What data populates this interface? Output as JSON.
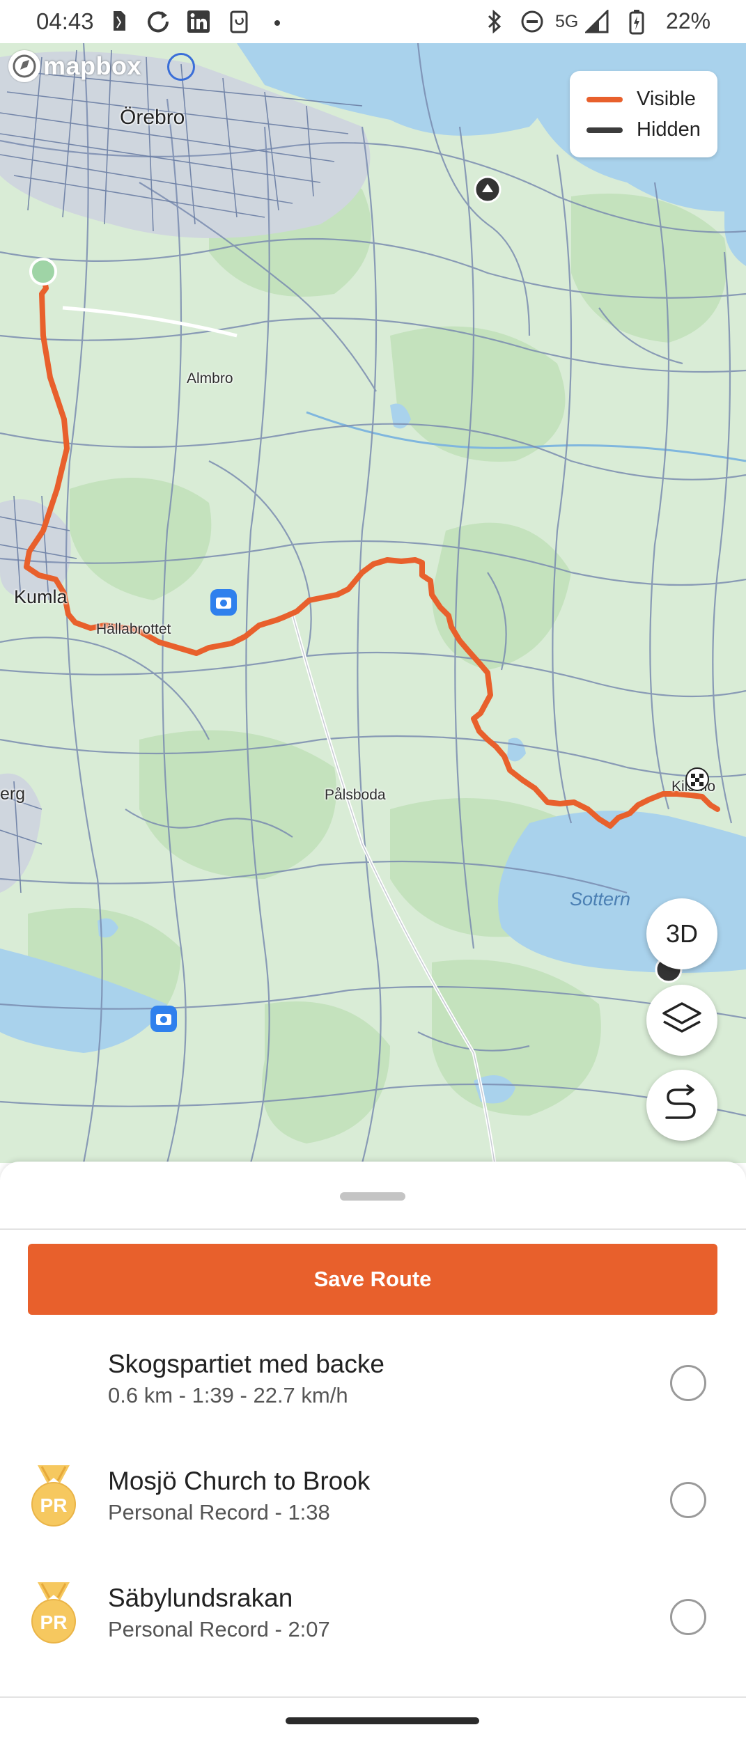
{
  "status_bar": {
    "time": "04:43",
    "network": "5G",
    "battery": "22%",
    "icons": [
      "sim-card-icon",
      "sync-icon",
      "linkedin-icon",
      "clipboard-icon",
      "dot-icon",
      "bluetooth-icon",
      "do-not-disturb-icon",
      "signal-icon",
      "battery-charging-icon"
    ]
  },
  "map": {
    "logo_text": "mapbox",
    "legend": [
      {
        "label": "Visible",
        "color": "#e8602c"
      },
      {
        "label": "Hidden",
        "color": "#3c3c3c"
      }
    ],
    "places": {
      "orebro": "Örebro",
      "almbro": "Almbro",
      "kumla": "Kumla",
      "hallabrottet": "Hällabrottet",
      "palsboda": "Pålsboda",
      "erg": "erg",
      "kilsmo": "Kilsmo",
      "sottern": "Sottern"
    },
    "route_color": "#e8602c",
    "buttons": {
      "three_d": "3D"
    }
  },
  "sheet": {
    "save_label": "Save Route",
    "segments": [
      {
        "title": "Skogspartiet med backe",
        "subtitle": "0.6 km - 1:39 - 22.7 km/h",
        "pr": false,
        "selected": false
      },
      {
        "title": "Mosjö Church to Brook",
        "subtitle": "Personal Record - 1:38",
        "pr": true,
        "pr_label": "PR",
        "selected": false
      },
      {
        "title": "Säbylundsrakan",
        "subtitle": "Personal Record - 2:07",
        "pr": true,
        "pr_label": "PR",
        "selected": false
      }
    ]
  }
}
